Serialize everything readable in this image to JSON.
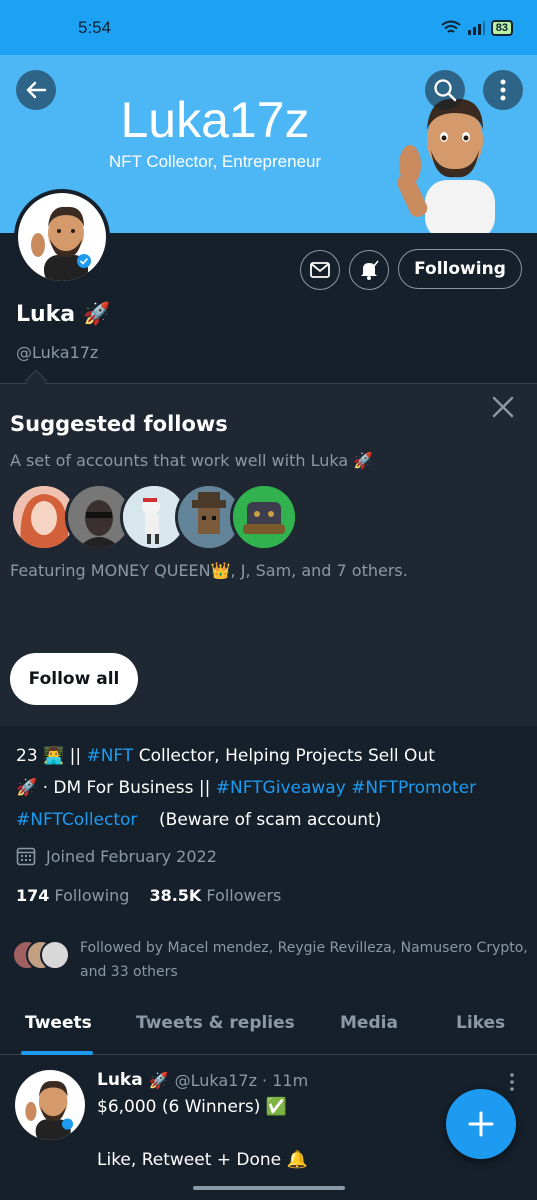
{
  "status_bar": {
    "time": "5:54",
    "battery": "83"
  },
  "banner": {
    "name": "Luka17z",
    "tagline": "NFT Collector, Entrepreneur"
  },
  "profile": {
    "following_button": "Following",
    "name": "Luka",
    "name_emoji": "🚀",
    "handle": "@Luka17z"
  },
  "suggested": {
    "title": "Suggested follows",
    "subtitle": "A set of accounts that work well with Luka 🚀",
    "featuring": "Featuring MONEY QUEEN👑, J, Sam, and 7 others.",
    "follow_all": "Follow all"
  },
  "bio": {
    "l1_a": "23 👨‍💻 || ",
    "l1_tag": "#NFT",
    "l1_b": " Collector, Helping Projects Sell Out",
    "l2_a": "🚀 · DM For Business || ",
    "l2_tag1": "#NFTGiveaway",
    "l2_space": " ",
    "l2_tag2": "#NFTPromoter",
    "l3_tag": "#NFTCollector",
    "l3_b": "    (Beware of scam account)"
  },
  "joined": "Joined February 2022",
  "stats": {
    "following_count": "174",
    "following_label": "Following",
    "followers_count": "38.5K",
    "followers_label": "Followers"
  },
  "followed_by": "Followed by Macel mendez, Reygie Revilleza, Namusero Crypto, and 33 others",
  "tabs": [
    "Tweets",
    "Tweets & replies",
    "Media",
    "Likes"
  ],
  "tweet": {
    "name": "Luka",
    "emoji": "🚀",
    "meta": "@Luka17z · 11m",
    "line1": "$6,000 (6 Winners) ✅",
    "line2": "Like, Retweet + Done 🔔"
  },
  "colors": {
    "accent": "#1d9bf0",
    "background": "#15202b",
    "banner": "#4db6f5"
  },
  "icons": [
    "back-arrow-icon",
    "search-icon",
    "more-vertical-icon",
    "mail-icon",
    "bell-icon",
    "close-icon",
    "calendar-icon",
    "compose-plus-icon"
  ]
}
